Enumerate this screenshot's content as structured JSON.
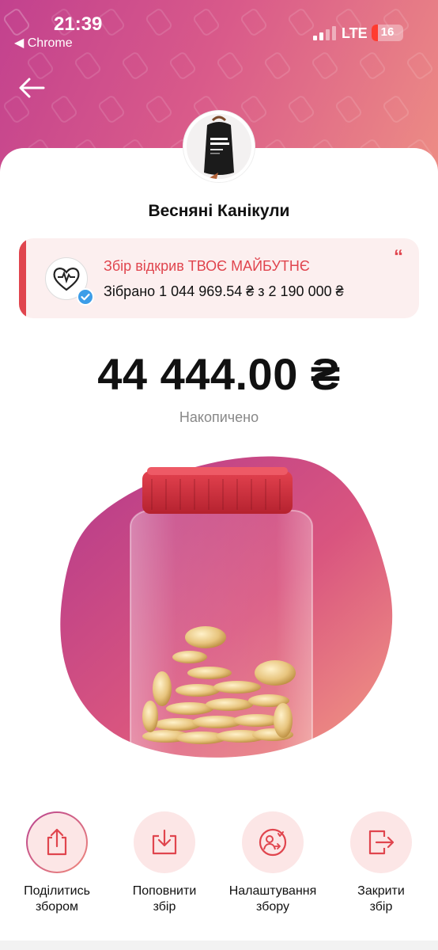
{
  "status_bar": {
    "time": "21:39",
    "back_app": "◀ Chrome",
    "network": "LTE",
    "battery": "16"
  },
  "jar": {
    "name": "Весняні Канікули",
    "amount": "44 444.00 ₴",
    "amount_label": "Накопичено"
  },
  "fundraiser": {
    "title": "Збір відкрив ТВОЄ МАЙБУТНЄ",
    "collected": "Зібрано 1 044 969.54 ₴ з 2 190 000 ₴",
    "quote_mark": "“"
  },
  "actions": [
    {
      "label": "Поділитись\nзбором",
      "icon": "share-icon"
    },
    {
      "label": "Поповнити\nзбір",
      "icon": "top-up-icon"
    },
    {
      "label": "Налаштування\nзбору",
      "icon": "settings-icon"
    },
    {
      "label": "Закрити\nзбір",
      "icon": "close-jar-icon"
    }
  ],
  "colors": {
    "accent": "#e0454e",
    "gradient_start": "#c2418e",
    "gradient_end": "#ee8f84",
    "icon_bg": "#fce6e6"
  }
}
